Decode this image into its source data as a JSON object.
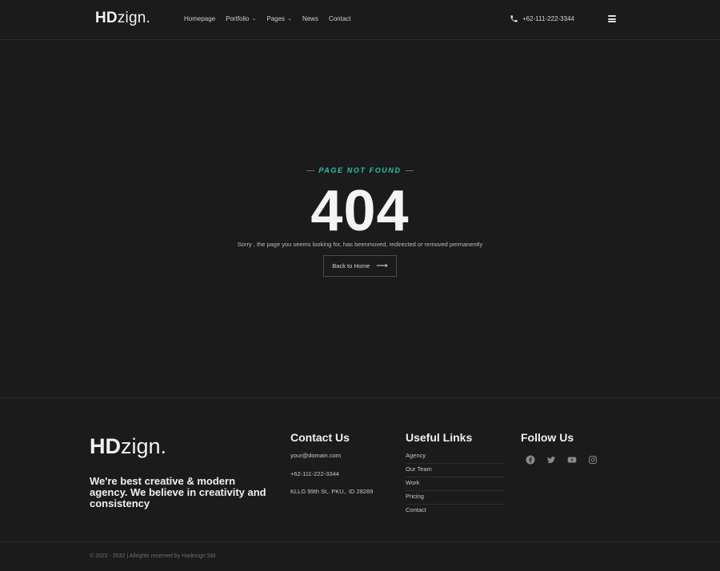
{
  "header": {
    "logo_bold": "HD",
    "logo_rest": "zign.",
    "nav": [
      {
        "label": "Homepage",
        "has_dropdown": false
      },
      {
        "label": "Portfolio",
        "has_dropdown": true
      },
      {
        "label": "Pages",
        "has_dropdown": true
      },
      {
        "label": "News",
        "has_dropdown": false
      },
      {
        "label": "Contact",
        "has_dropdown": false
      }
    ],
    "phone": "+62-111-222-3344",
    "phone_icon": "phone-icon",
    "menu_icon": "hamburger-menu-icon"
  },
  "error": {
    "eyebrow": "PAGE NOT FOUND",
    "code": "404",
    "message": "Sorry , the page you seems looking for, has beenmoved, redirected or removed permanently",
    "button_label": "Back to Home",
    "button_icon": "arrow-right-icon"
  },
  "footer": {
    "logo_bold": "HD",
    "logo_rest": "zign.",
    "tagline": "We're best creative & modern agency. We believe in creativity and consistency",
    "contact": {
      "title": "Contact Us",
      "email": "your@domain.com",
      "phone": "+62-111-222-3344",
      "address": "KLLG 99th St,. PKU,. ID 28289"
    },
    "links": {
      "title": "Useful Links",
      "items": [
        "Agency",
        "Our Team",
        "Work",
        "Pricing",
        "Contact"
      ]
    },
    "follow": {
      "title": "Follow Us",
      "icons": [
        "facebook-icon",
        "twitter-icon",
        "youtube-icon",
        "instagram-icon"
      ]
    },
    "copyright": "© 2022 - 2032 | Allrights reserved by Hadezign Std"
  },
  "colors": {
    "background": "#1b1b1b",
    "accent": "#27c1a6",
    "text": "#f2f2f2"
  }
}
